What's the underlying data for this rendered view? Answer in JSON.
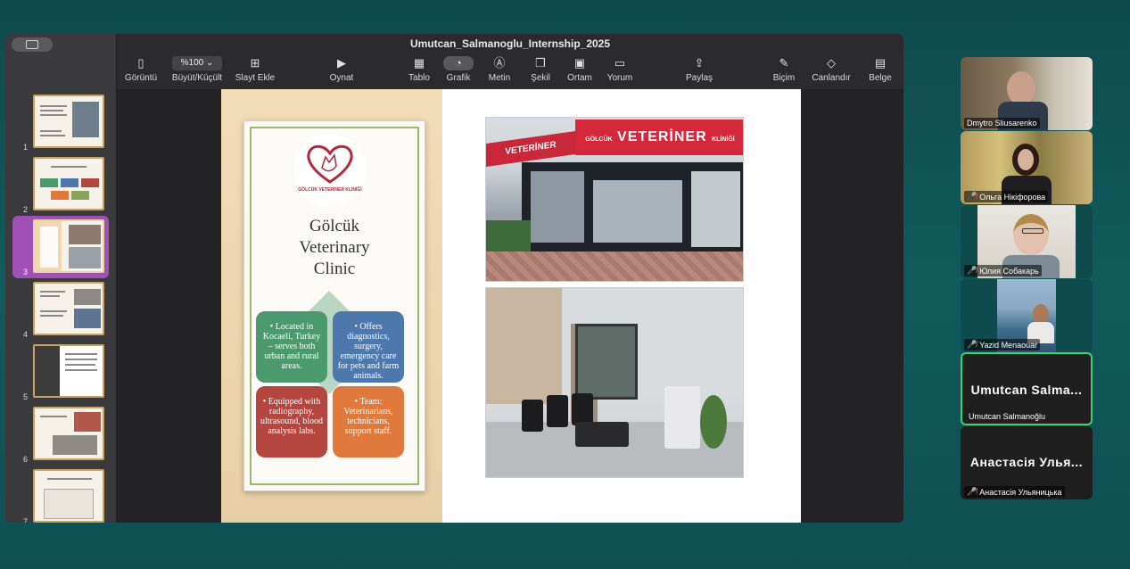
{
  "window": {
    "title": "Umutcan_Salmanoglu_Internship_2025"
  },
  "toolbar": {
    "items": [
      {
        "label": "Görüntü",
        "icon": "sidebar-view-icon"
      },
      {
        "label": "Büyüt/Küçült",
        "value": "%100",
        "icon": "zoom-dropdown"
      },
      {
        "label": "Slayt Ekle",
        "icon": "add-slide-icon"
      },
      {
        "label": "Oynat",
        "icon": "play-icon"
      },
      {
        "label": "Tablo",
        "icon": "table-icon"
      },
      {
        "label": "Grafik",
        "icon": "chart-icon"
      },
      {
        "label": "Metin",
        "icon": "text-icon"
      },
      {
        "label": "Şekil",
        "icon": "shape-icon"
      },
      {
        "label": "Ortam",
        "icon": "media-icon"
      },
      {
        "label": "Yorum",
        "icon": "comment-icon"
      },
      {
        "label": "Paylaş",
        "icon": "share-icon"
      },
      {
        "label": "Biçim",
        "icon": "format-icon"
      },
      {
        "label": "Canlandır",
        "icon": "animate-icon"
      },
      {
        "label": "Belge",
        "icon": "document-icon"
      }
    ]
  },
  "slides": {
    "numbers": [
      "1",
      "2",
      "3",
      "4",
      "5",
      "6",
      "7"
    ],
    "selected": "3"
  },
  "slide": {
    "logo_text": "GÖLCÜK VETERİNER KLİNİĞİ",
    "title_lines": [
      "Gölcük",
      "Veterinary",
      "Clinic"
    ],
    "boxes": [
      "• Located in Kocaeli, Turkey – serves both urban and rural areas.",
      "• Offers diagnostics, surgery, emergency care for pets and farm animals.",
      "• Equipped with radiography, ultrasound, blood analysis labs.",
      "• Team: Veterinarians, technicians, support staff."
    ],
    "sign_main": "VETERİNER",
    "sign_brand": "GÖLCÜK",
    "sign_small": "KLİNİĞİ",
    "sign_side": "VETERİNER"
  },
  "participants": [
    {
      "name": "Dmytro Sliusarenko",
      "muted": false
    },
    {
      "name": "Ольга Нікіфорова",
      "muted": true
    },
    {
      "name": "Юлия Собакарь",
      "muted": true
    },
    {
      "name": "Yazid Menaouar",
      "muted": true
    },
    {
      "name": "Umutcan Salmanoğlu",
      "display": "Umutcan  Salma...",
      "muted": false,
      "active": true
    },
    {
      "name": "Анастасія Ульяницька",
      "display": "Анастасія Улья...",
      "muted": true
    }
  ],
  "colors": {
    "selection": "#a04fb3",
    "active_speaker": "#3fd36b",
    "mute": "#e0463e"
  }
}
